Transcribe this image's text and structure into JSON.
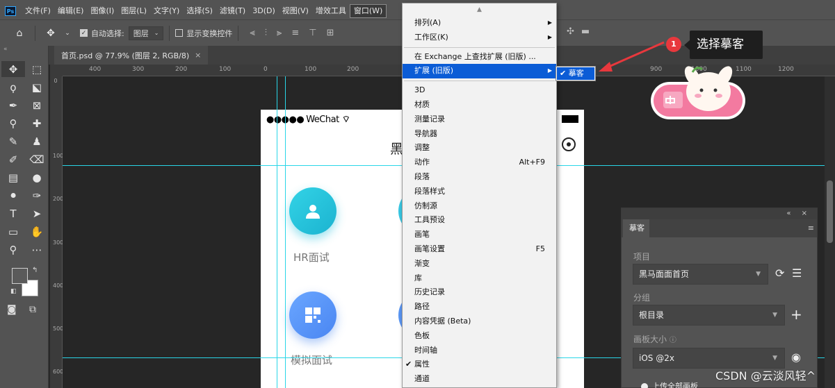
{
  "menubar": {
    "logo": "Ps",
    "items": [
      "文件(F)",
      "编辑(E)",
      "图像(I)",
      "图层(L)",
      "文字(Y)",
      "选择(S)",
      "滤镜(T)",
      "3D(D)",
      "视图(V)",
      "增效工具",
      "窗口(W)"
    ]
  },
  "options": {
    "auto_select_label": "自动选择:",
    "layer_select": "图层",
    "show_transform_label": "显示变换控件"
  },
  "document_tab": {
    "title": "首页.psd @ 77.9% (图层 2, RGB/8)",
    "close": "×"
  },
  "ruler": {
    "h_ticks": [
      "400",
      "300",
      "200",
      "100",
      "0",
      "100",
      "200",
      "900",
      "1000",
      "1100",
      "1200"
    ],
    "v_ticks": [
      "0",
      "100",
      "200",
      "300",
      "400",
      "500",
      "600"
    ]
  },
  "artboard": {
    "status_dots": "●●●●●",
    "carrier": "WeChat",
    "wifi": "⌔",
    "heading_fragment": "黑",
    "features": [
      {
        "label": "HR面试",
        "icon": "person-icon"
      },
      {
        "label": "模拟面试",
        "icon": "grid-icon"
      }
    ]
  },
  "window_menu": {
    "scroll_up": "▲",
    "items": [
      {
        "label": "排列(A)",
        "submenu": true
      },
      {
        "label": "工作区(K)",
        "submenu": true
      },
      {
        "separator": true
      },
      {
        "label": "在 Exchange 上查找扩展 (旧版) ..."
      },
      {
        "label": "扩展 (旧版)",
        "submenu": true,
        "highlight": true
      },
      {
        "separator": true
      },
      {
        "label": "3D"
      },
      {
        "label": "材质"
      },
      {
        "label": "测量记录"
      },
      {
        "label": "导航器"
      },
      {
        "label": "调整"
      },
      {
        "label": "动作",
        "shortcut": "Alt+F9"
      },
      {
        "label": "段落"
      },
      {
        "label": "段落样式"
      },
      {
        "label": "仿制源"
      },
      {
        "label": "工具预设"
      },
      {
        "label": "画笔"
      },
      {
        "label": "画笔设置",
        "shortcut": "F5"
      },
      {
        "label": "渐变"
      },
      {
        "label": "库"
      },
      {
        "label": "历史记录"
      },
      {
        "label": "路径"
      },
      {
        "label": "内容凭据 (Beta)"
      },
      {
        "label": "色板"
      },
      {
        "label": "时间轴"
      },
      {
        "label": "属性",
        "checked": true
      },
      {
        "label": "通道"
      }
    ],
    "submenu_item": "✔ 摹客"
  },
  "annotation": {
    "step": "1",
    "text": "选择摹客"
  },
  "panel": {
    "header_icons": "« ×",
    "tab": "摹客",
    "menu_icon": "≡",
    "project_label": "项目",
    "project_value": "黑马面面首页",
    "group_label": "分组",
    "group_value": "根目录",
    "size_label": "画板大小",
    "size_value": "iOS @2x",
    "upload_label": "上传全部画板"
  },
  "watermark": "CSDN @云淡风轻^",
  "colors": {
    "menu_highlight": "#0b5cd6",
    "guide": "#29d6e8",
    "badge": "#e8383d"
  }
}
